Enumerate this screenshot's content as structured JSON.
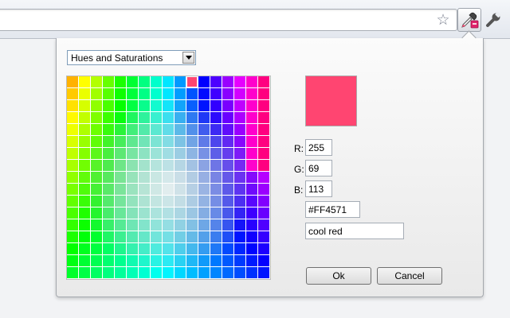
{
  "toolbar": {
    "icons": [
      "bookmark-star-icon",
      "eyedropper-icon",
      "wrench-icon"
    ]
  },
  "picker": {
    "mode": "Hues and Saturations",
    "selected_color": "#FF4571",
    "r_label": "R:",
    "g_label": "G:",
    "b_label": "B:",
    "r": "255",
    "g": "69",
    "b": "113",
    "hex": "#FF4571",
    "name": "cool red",
    "ok_label": "Ok",
    "cancel_label": "Cancel",
    "grid_columns": 17,
    "grid_rows": 17,
    "selected_cell": {
      "row": 0,
      "col": 10
    }
  }
}
